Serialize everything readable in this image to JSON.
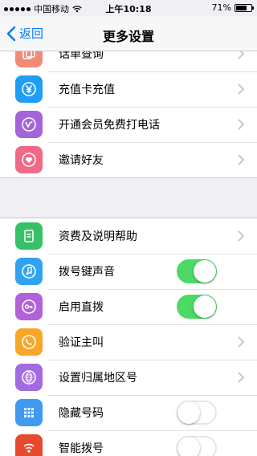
{
  "status": {
    "carrier": "中国移动",
    "time": "上午10:18",
    "battery": "71%",
    "battery_level": 0.71
  },
  "nav": {
    "back_label": "返回",
    "title": "更多设置"
  },
  "section1": [
    {
      "label": "话单查询"
    },
    {
      "label": "充值卡充值"
    },
    {
      "label": "开通会员免费打电话"
    },
    {
      "label": "邀请好友"
    }
  ],
  "section2": [
    {
      "label": "资费及说明帮助",
      "control": "chevron"
    },
    {
      "label": "拨号键声音",
      "control": "toggle",
      "state": "on"
    },
    {
      "label": "启用直拨",
      "control": "toggle",
      "state": "on"
    },
    {
      "label": "验证主叫",
      "control": "chevron"
    },
    {
      "label": "设置归属地区号",
      "control": "chevron"
    },
    {
      "label": "隐藏号码",
      "control": "toggle",
      "state": "off"
    },
    {
      "label": "智能拨号",
      "control": "toggle",
      "state": "off"
    }
  ],
  "colors": {
    "accent": "#007aff",
    "toggle_on": "#4cd964"
  }
}
